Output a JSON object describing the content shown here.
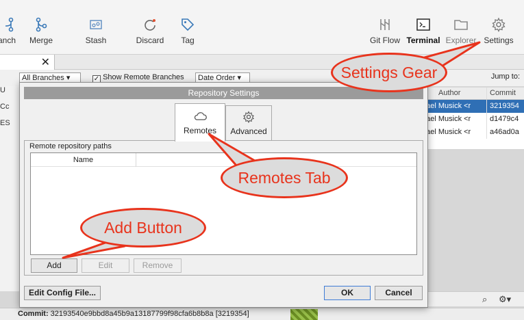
{
  "toolbar": {
    "branch": "anch",
    "merge": "Merge",
    "stash": "Stash",
    "discard": "Discard",
    "tag": "Tag",
    "git_flow": "Git Flow",
    "terminal": "Terminal",
    "explorer": "Explorer",
    "settings": "Settings"
  },
  "repo_tab": {
    "close": "✕"
  },
  "log_bar": {
    "branches_filter": "All Branches",
    "show_remote": "Show Remote Branches",
    "order": "Date Order",
    "jump_to": "Jump to:"
  },
  "left_stub": {
    "l1": "U",
    "l2": "Cc",
    "l3": "ES"
  },
  "commit_table": {
    "headers": [
      "Author",
      "Commit"
    ],
    "rows": [
      {
        "author": "hael Musick <r",
        "commit": "3219354",
        "selected": true
      },
      {
        "author": "hael Musick <r",
        "commit": "d1479c4",
        "selected": false
      },
      {
        "author": "hael Musick <r",
        "commit": "a46ad0a",
        "selected": false
      }
    ]
  },
  "dialog": {
    "title": "Repository Settings",
    "tabs": [
      {
        "label": "Remotes",
        "icon": "cloud-icon",
        "active": true
      },
      {
        "label": "Advanced",
        "icon": "gear-icon",
        "active": false
      }
    ],
    "group_label": "Remote repository paths",
    "list_columns": [
      "Name"
    ],
    "buttons": {
      "add": "Add",
      "edit": "Edit",
      "remove": "Remove",
      "edit_config": "Edit Config File...",
      "ok": "OK",
      "cancel": "Cancel"
    }
  },
  "status": {
    "commit_label": "Commit:",
    "commit_value": "32193540e9bbd8a45b9a13187799f98cfa6b8b8a [3219354]"
  },
  "annotations": {
    "settings": "Settings Gear",
    "remotes": "Remotes Tab",
    "add": "Add Button"
  },
  "colors": {
    "accent": "#2f6fb5",
    "annotation": "#e8331c"
  }
}
